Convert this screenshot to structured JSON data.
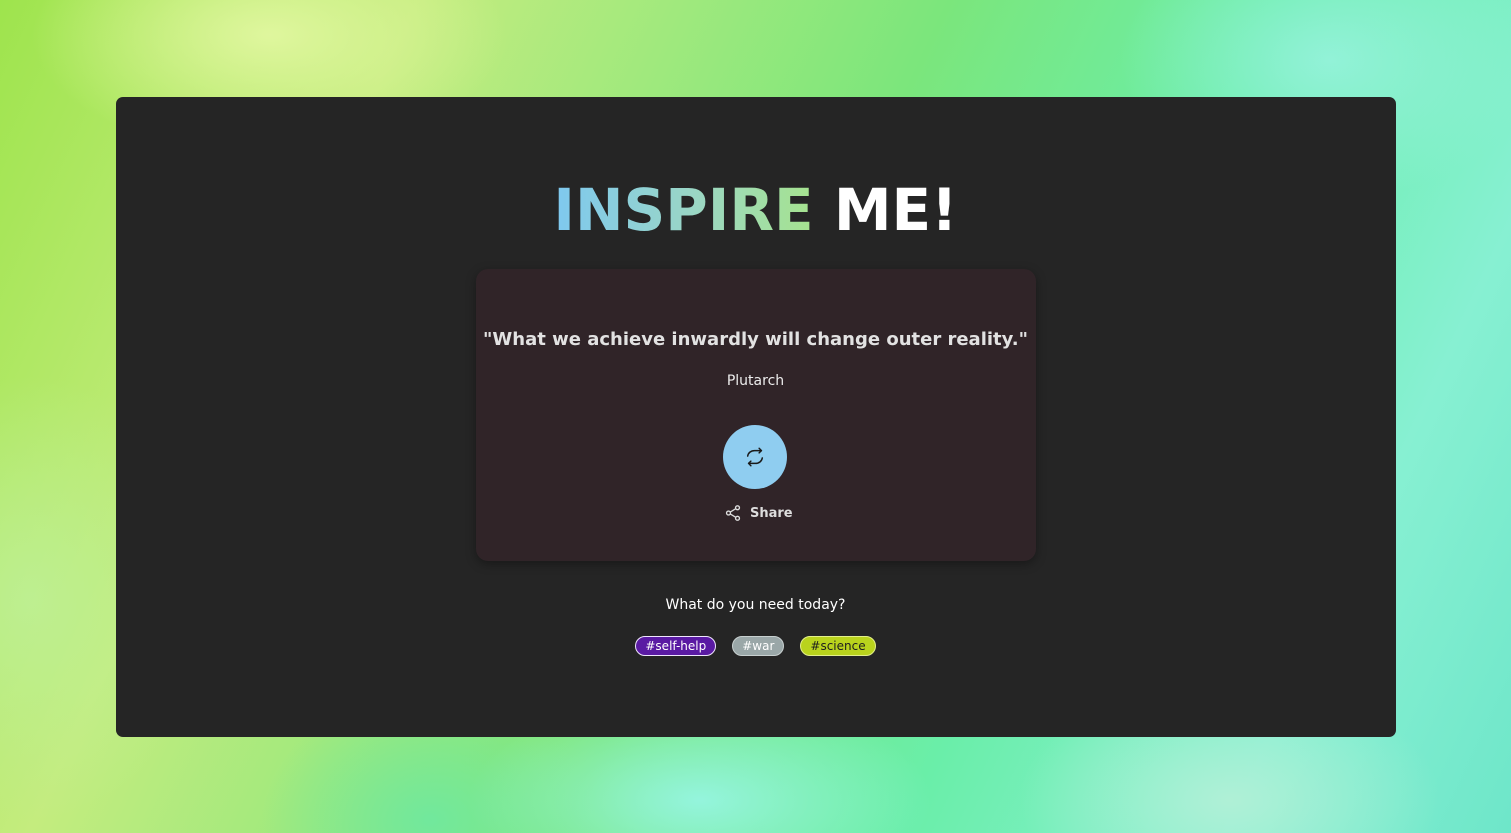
{
  "app": {
    "title_part1": "INSPIRE",
    "title_part2": "ME!"
  },
  "quote": {
    "text": "\"What we achieve inwardly will change outer reality.\"",
    "author": "Plutarch"
  },
  "actions": {
    "refresh_icon": "refresh-icon",
    "share_label": "Share",
    "share_icon": "share-icon"
  },
  "prompt": {
    "question": "What do you need today?"
  },
  "tags": [
    {
      "label": "#self-help",
      "color": "#5a1aa3"
    },
    {
      "label": "#war",
      "color": "#9aa7a8"
    },
    {
      "label": "#science",
      "color": "#b9d31d"
    }
  ],
  "colors": {
    "card_background": "#252525",
    "quote_card_background": "#302428",
    "refresh_button": "#8fcdf0"
  }
}
